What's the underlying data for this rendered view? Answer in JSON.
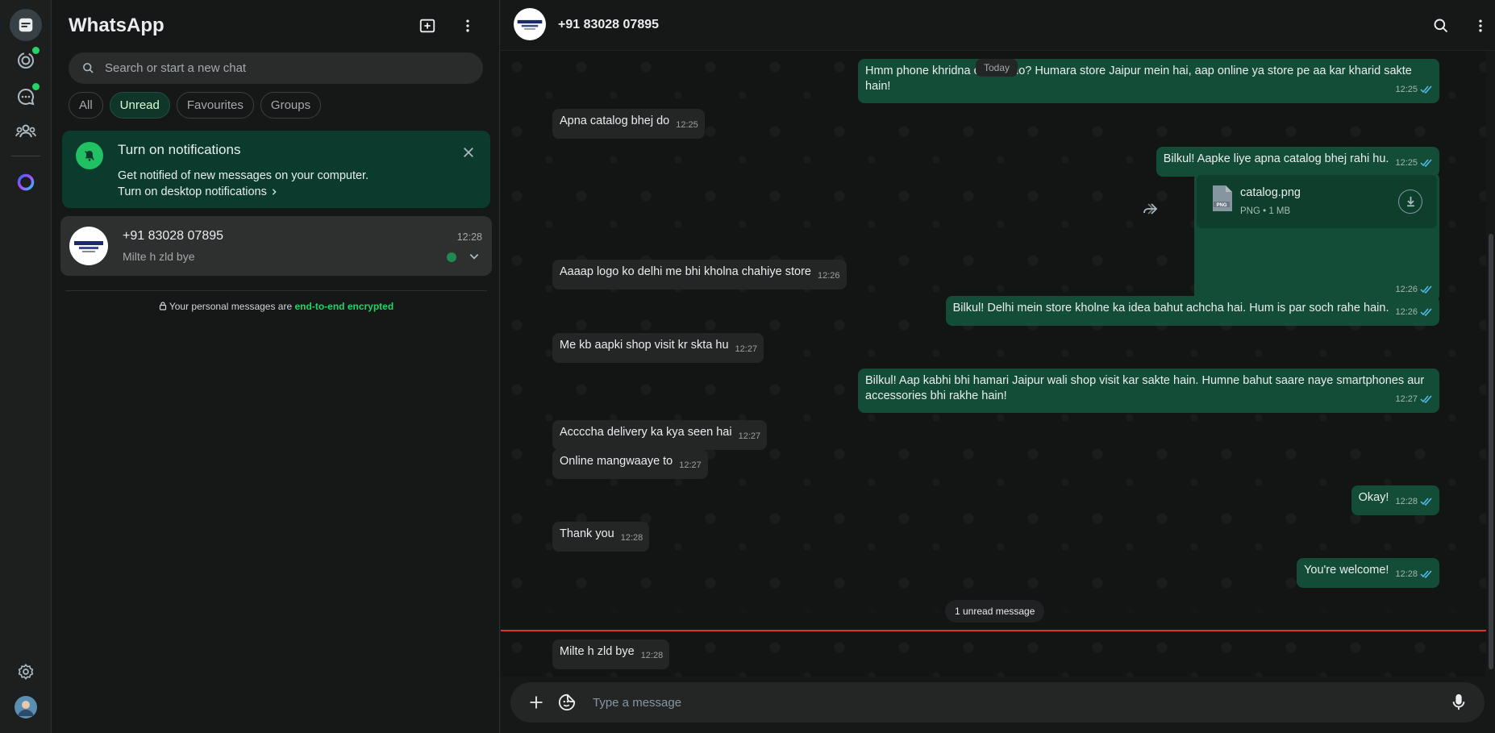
{
  "app": {
    "title": "WhatsApp"
  },
  "rail": {
    "items": [
      {
        "name": "chats-icon",
        "active": true
      },
      {
        "name": "status-icon",
        "dot": true
      },
      {
        "name": "channels-icon",
        "dot": true
      },
      {
        "name": "communities-icon"
      },
      {
        "name": "meta-ai-icon"
      }
    ],
    "bottom": [
      {
        "name": "settings-icon"
      },
      {
        "name": "profile-avatar"
      }
    ]
  },
  "list": {
    "search_placeholder": "Search or start a new chat",
    "filters": [
      "All",
      "Unread",
      "Favourites",
      "Groups"
    ],
    "active_filter": "Unread",
    "notification": {
      "title": "Turn on notifications",
      "body": "Get notified of new messages on your computer.",
      "link": "Turn on desktop notifications"
    },
    "chats": [
      {
        "name": "+91 83028 07895",
        "time": "12:28",
        "preview": "Milte h zld bye",
        "unread": true
      }
    ],
    "e2e_text": "Your personal messages are",
    "e2e_link": "end-to-end encrypted"
  },
  "conversation": {
    "contact": "+91 83028 07895",
    "date_label": "Today",
    "messages": [
      {
        "dir": "out",
        "text": "Hmm phone khridna chahte ho?  Humara store Jaipur mein hai, aap online ya store pe aa kar kharid sakte hain!",
        "time": "12:25"
      },
      {
        "dir": "in",
        "text": "Apna catalog bhej do",
        "time": "12:25"
      },
      {
        "dir": "out",
        "text": "Bilkul!  Aapke liye apna catalog bhej rahi hu.",
        "time": "12:25"
      },
      {
        "dir": "out",
        "type": "file",
        "file_name": "catalog.png",
        "file_meta": "PNG • 1 MB",
        "file_badge": "PNG",
        "time": "12:26"
      },
      {
        "dir": "in",
        "text": "Aaaap logo ko delhi me bhi kholna chahiye store",
        "time": "12:26"
      },
      {
        "dir": "out",
        "text": "Bilkul!  Delhi mein store kholne ka idea bahut achcha hai. Hum is par soch rahe hain.",
        "time": "12:26"
      },
      {
        "dir": "in",
        "text": "Me kb aapki shop visit kr skta hu",
        "time": "12:27"
      },
      {
        "dir": "out",
        "text": "Bilkul!  Aap kabhi bhi hamari Jaipur wali shop visit kar sakte hain.  Humne bahut saare naye smartphones aur accessories bhi rakhe hain!",
        "time": "12:27"
      },
      {
        "dir": "in",
        "text": "Accccha delivery ka kya seen hai",
        "time": "12:27"
      },
      {
        "dir": "in",
        "text": "Online mangwaaye to",
        "time": "12:27"
      },
      {
        "dir": "out",
        "text": "Okay!",
        "time": "12:28"
      },
      {
        "dir": "in",
        "text": "Thank you",
        "time": "12:28"
      },
      {
        "dir": "out",
        "text": "You're welcome!",
        "time": "12:28"
      },
      {
        "dir": "in",
        "text": "Milte h zld bye",
        "time": "12:28"
      }
    ],
    "unread_label": "1 unread message",
    "composer_placeholder": "Type a message"
  },
  "colors": {
    "accent": "#25d366",
    "outgoing": "#144d37",
    "incoming": "#242626",
    "unread_line": "#e03131"
  }
}
